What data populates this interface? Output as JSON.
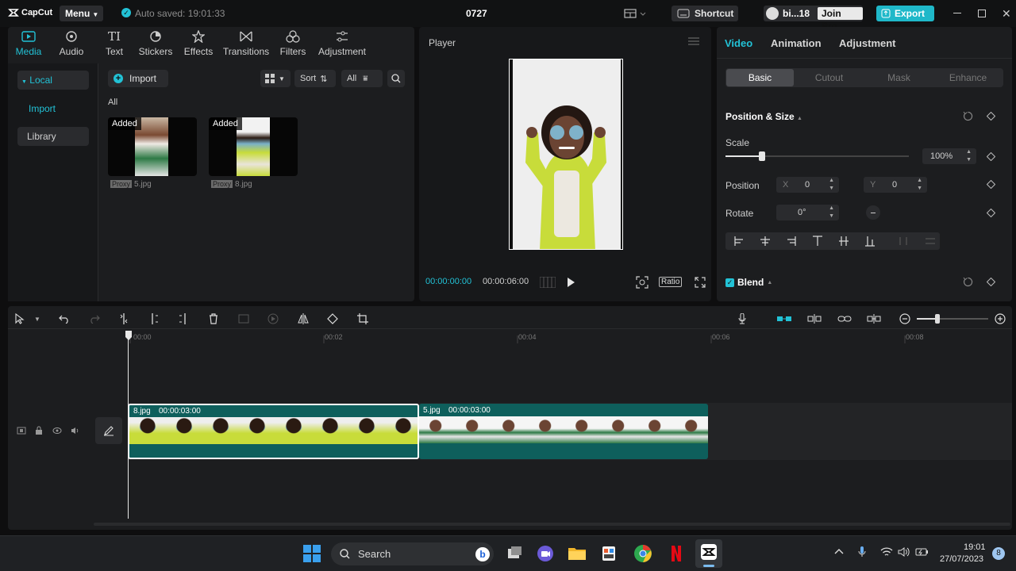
{
  "app": {
    "logo": "CapCut",
    "menu_label": "Menu",
    "autosave": "Auto saved: 19:01:33",
    "project_name": "0727",
    "shortcut_label": "Shortcut",
    "user": "bi...18",
    "join_pro": "Join Pro",
    "export_label": "Export"
  },
  "toolbar": [
    {
      "label": "Media",
      "icon": "media-icon"
    },
    {
      "label": "Audio",
      "icon": "audio-icon"
    },
    {
      "label": "Text",
      "icon": "text-icon"
    },
    {
      "label": "Stickers",
      "icon": "stickers-icon"
    },
    {
      "label": "Effects",
      "icon": "effects-icon"
    },
    {
      "label": "Transitions",
      "icon": "transitions-icon"
    },
    {
      "label": "Filters",
      "icon": "filters-icon"
    },
    {
      "label": "Adjustment",
      "icon": "adjustment-icon"
    }
  ],
  "media_sidebar": {
    "local": "Local",
    "import": "Import",
    "library": "Library"
  },
  "media": {
    "import_label": "Import",
    "sort_label": "Sort",
    "filter_label": "All",
    "section_label": "All",
    "items": [
      {
        "badge": "Added",
        "proxy": "Proxy",
        "name": "5.jpg"
      },
      {
        "badge": "Added",
        "proxy": "Proxy",
        "name": "8.jpg"
      }
    ]
  },
  "player": {
    "title": "Player",
    "current_time": "00:00:00:00",
    "total_time": "00:00:06:00",
    "ratio_label": "Ratio"
  },
  "inspector": {
    "tabs": [
      "Video",
      "Animation",
      "Adjustment"
    ],
    "subtabs": [
      "Basic",
      "Cutout",
      "Mask",
      "Enhance"
    ],
    "position_size": "Position & Size",
    "scale_label": "Scale",
    "scale_value": "100%",
    "scale_fraction": 0.2,
    "position_label": "Position",
    "x_label": "X",
    "x_value": "0",
    "y_label": "Y",
    "y_value": "0",
    "rotate_label": "Rotate",
    "rotate_value": "0°",
    "blend_label": "Blend"
  },
  "timeline": {
    "ticks": [
      "00:00",
      "00:02",
      "00:04",
      "00:06",
      "00:08"
    ],
    "clips": [
      {
        "name": "8.jpg",
        "duration": "00:00:03:00"
      },
      {
        "name": "5.jpg",
        "duration": "00:00:03:00"
      }
    ]
  },
  "taskbar": {
    "search_label": "Search",
    "time": "19:01",
    "date": "27/07/2023",
    "notifications": "8"
  },
  "colors": {
    "accent": "#22c2d6",
    "clip_teal": "#0e5f5c",
    "export_bg": "#1fb8c9",
    "jacket_green": "#c8dc3a"
  }
}
